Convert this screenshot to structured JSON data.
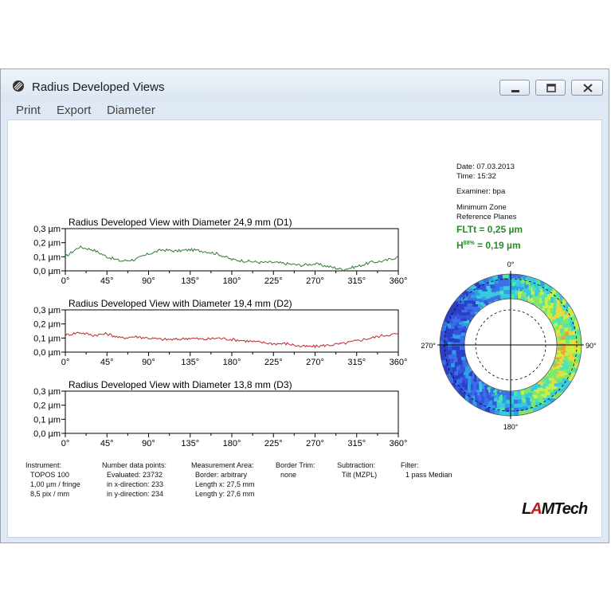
{
  "window": {
    "title": "Radius Developed Views",
    "menu": [
      "Print",
      "Export",
      "Diameter"
    ]
  },
  "info": {
    "date": "Date: 07.03.2013",
    "time": "Time: 15:32",
    "examiner": "Examiner: bpa",
    "zone1": "Minimum Zone",
    "zone2": "Reference Planes",
    "fltt": "FLTt  = 0,25 µm",
    "h88_prefix": "H",
    "h88_sup": "88%",
    "h88_value": " = 0,19 µm"
  },
  "polar": {
    "top": "0°",
    "bottom": "180°",
    "left": "270°",
    "right": "90°"
  },
  "chart_data": [
    {
      "type": "line",
      "title": "Radius Developed View with Diameter 24,9 mm (D1)",
      "x_ticks": [
        "0°",
        "45°",
        "90°",
        "135°",
        "180°",
        "225°",
        "270°",
        "315°",
        "360°"
      ],
      "y_ticks": [
        "0,3 µm",
        "0,2 µm",
        "0,1 µm",
        "0,0 µm"
      ],
      "xlim": [
        0,
        360
      ],
      "ylim": [
        0,
        0.3
      ],
      "color": "#2e7d2e",
      "series": {
        "x": [
          0,
          15,
          30,
          45,
          60,
          75,
          90,
          105,
          120,
          135,
          150,
          165,
          180,
          195,
          210,
          225,
          240,
          255,
          270,
          285,
          300,
          315,
          330,
          345,
          360
        ],
        "y": [
          0.1,
          0.17,
          0.15,
          0.1,
          0.07,
          0.08,
          0.12,
          0.15,
          0.14,
          0.15,
          0.14,
          0.12,
          0.08,
          0.07,
          0.06,
          0.06,
          0.05,
          0.04,
          0.05,
          0.03,
          0.01,
          0.03,
          0.06,
          0.07,
          0.1
        ]
      }
    },
    {
      "type": "line",
      "title": "Radius Developed View with Diameter 19,4 mm (D2)",
      "x_ticks": [
        "0°",
        "45°",
        "90°",
        "135°",
        "180°",
        "225°",
        "270°",
        "315°",
        "360°"
      ],
      "y_ticks": [
        "0,3 µm",
        "0,2 µm",
        "0,1 µm",
        "0,0 µm"
      ],
      "xlim": [
        0,
        360
      ],
      "ylim": [
        0,
        0.3
      ],
      "color": "#c0282b",
      "series": {
        "x": [
          0,
          15,
          30,
          45,
          60,
          75,
          90,
          105,
          120,
          135,
          150,
          165,
          180,
          195,
          210,
          225,
          240,
          255,
          270,
          285,
          300,
          315,
          330,
          345,
          360
        ],
        "y": [
          0.12,
          0.14,
          0.12,
          0.13,
          0.1,
          0.11,
          0.1,
          0.09,
          0.09,
          0.1,
          0.09,
          0.1,
          0.09,
          0.08,
          0.07,
          0.06,
          0.06,
          0.04,
          0.04,
          0.05,
          0.06,
          0.08,
          0.1,
          0.12,
          0.13
        ]
      }
    },
    {
      "type": "line",
      "title": "Radius Developed View with Diameter 13,8 mm (D3)",
      "x_ticks": [
        "0°",
        "45°",
        "90°",
        "135°",
        "180°",
        "225°",
        "270°",
        "315°",
        "360°"
      ],
      "y_ticks": [
        "0,3 µm",
        "0,2 µm",
        "0,1 µm",
        "0,0 µm"
      ],
      "xlim": [
        0,
        360
      ],
      "ylim": [
        0,
        0.3
      ],
      "color": "#000000",
      "series": {
        "x": [],
        "y": []
      }
    }
  ],
  "footer": {
    "instrument": [
      "Instrument:",
      "TOPOS 100",
      "1,00 µm / fringe",
      "8,5 pix / mm"
    ],
    "datapoints": [
      "Number data points:",
      "Evaluated: 23732",
      "in x-direction: 233",
      "in y-direction: 234"
    ],
    "area": [
      "Measurement Area:",
      "Border: arbitrary",
      "Length x: 27,5 mm",
      "Length y: 27,6 mm"
    ],
    "trim": [
      "Border Trim:",
      "none"
    ],
    "subtraction": [
      "Subtraction:",
      "Tilt (MZPL)"
    ],
    "filter": [
      "Filter:",
      "1 pass Median"
    ]
  },
  "logo": {
    "l": "L",
    "a": "A",
    "rest": "MTech"
  }
}
